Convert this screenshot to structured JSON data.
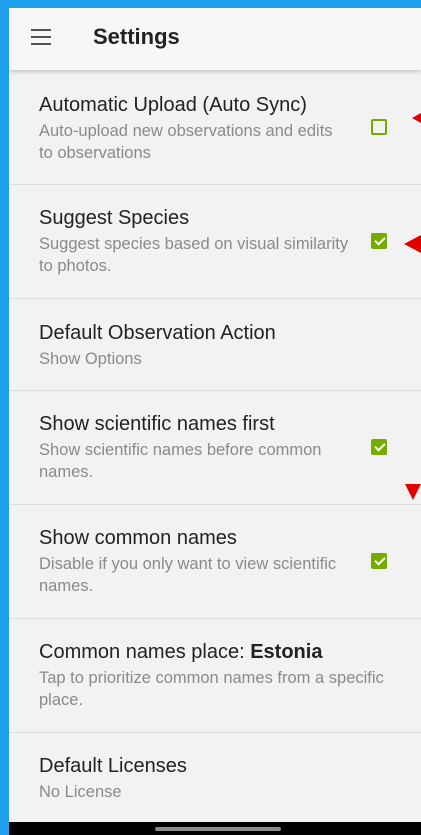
{
  "toolbar": {
    "title": "Settings",
    "menu_icon": "hamburger-menu-icon"
  },
  "settings": [
    {
      "title": "Automatic Upload (Auto Sync)",
      "subtitle": "Auto-upload new observations and edits to observations",
      "checked": false
    },
    {
      "title": "Suggest Species",
      "subtitle": "Suggest species based on visual similarity to photos.",
      "checked": true
    },
    {
      "title": "Default Observation Action",
      "subtitle": "Show Options"
    },
    {
      "title": "Show scientific names first",
      "subtitle": "Show scientific names before common names.",
      "checked": true
    },
    {
      "title": "Show common names",
      "subtitle": "Disable if you only want to view scientific names.",
      "checked": true
    },
    {
      "title_prefix": "Common names place: ",
      "title_value": "Estonia",
      "subtitle": "Tap to prioritize common names from a specific place."
    },
    {
      "title": "Default Licenses",
      "subtitle": "No License"
    }
  ],
  "colors": {
    "accent": "#74ac00",
    "frame": "#1ea0ec",
    "arrow": "#e00000"
  }
}
